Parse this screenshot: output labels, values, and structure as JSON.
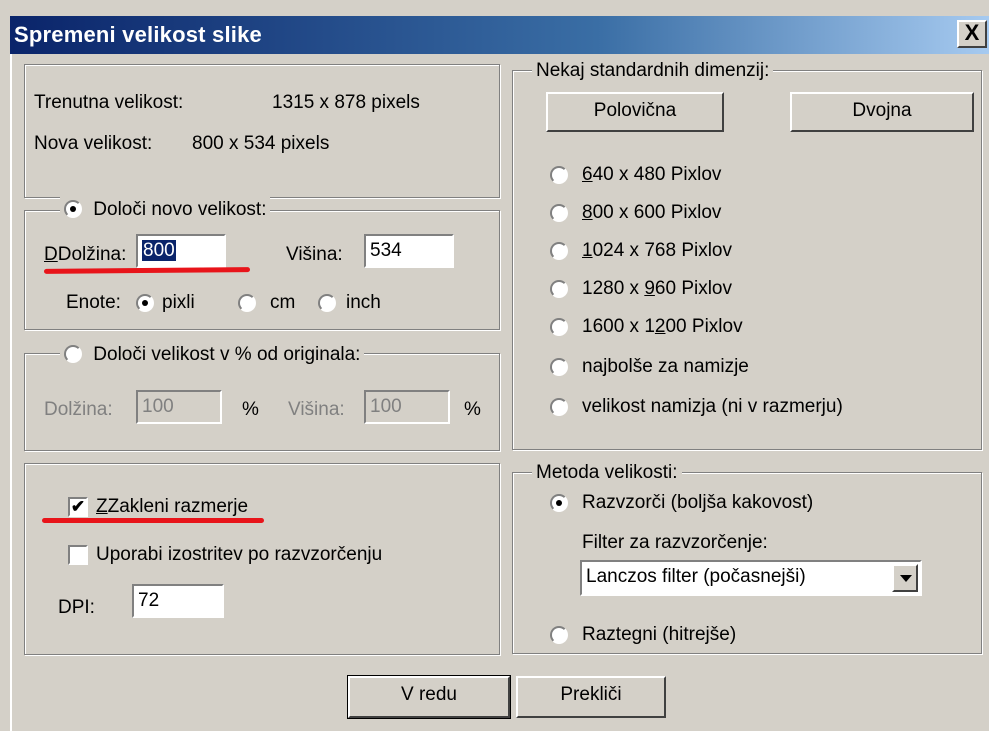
{
  "window": {
    "title": "Spremeni velikost slike",
    "close_label": "X"
  },
  "size_info": {
    "current_label": "Trenutna velikost:",
    "current_value": "1315  x  878  pixels",
    "new_label": "Nova velikost:",
    "new_value": "800  x  534  pixels"
  },
  "new_size": {
    "legend": "Določi novo velikost:",
    "selected": true,
    "length_label": "Dolžina:",
    "length_value": "800",
    "height_label": "Višina:",
    "height_value": "534",
    "units_label": "Enote:",
    "units": [
      {
        "label": "pixli",
        "selected": true
      },
      {
        "label": "cm",
        "selected": false
      },
      {
        "label": "inch",
        "selected": false
      }
    ]
  },
  "percent_size": {
    "legend": "Določi velikost v % od originala:",
    "selected": false,
    "length_label": "Dolžina:",
    "length_value": "100",
    "percent_symbol": "%",
    "height_label": "Višina:",
    "height_value": "100"
  },
  "options": {
    "lock_ratio_label": "Zakleni razmerje",
    "lock_ratio_checked": true,
    "sharpen_label": "Uporabi izostritev po razvzorčenju",
    "sharpen_checked": false,
    "dpi_label": "DPI:",
    "dpi_value": "72"
  },
  "standard_dims": {
    "legend": "Nekaj standardnih dimenzij:",
    "half_button": "Polovična",
    "double_button": "Dvojna",
    "presets": [
      {
        "key": "6",
        "rest": "40 x 480 Pixlov"
      },
      {
        "key": "8",
        "rest": "00 x 600 Pixlov"
      },
      {
        "key": "1",
        "rest": "024 x 768 Pixlov"
      },
      {
        "pre": "1280 x ",
        "key": "9",
        "rest": "60 Pixlov"
      },
      {
        "pre": "1600 x 1",
        "key": "2",
        "rest": "00 Pixlov"
      }
    ],
    "best_desktop": "najbolše za namizje",
    "desktop_size": "velikost namizja (ni v razmerju)"
  },
  "method": {
    "legend": "Metoda velikosti:",
    "resample_label": "Razvzorči (boljša kakovost)",
    "resample_selected": true,
    "filter_label": "Filter za razvzorčenje:",
    "filter_value": "Lanczos filter (počasnejši)",
    "stretch_label": "Raztegni (hitrejše)",
    "stretch_selected": false
  },
  "buttons": {
    "ok": "V redu",
    "cancel": "Prekliči"
  },
  "colors": {
    "face": "#d4d0c8",
    "title_start": "#0a246a",
    "title_end": "#a6caf0",
    "annotation": "#e8141a"
  }
}
